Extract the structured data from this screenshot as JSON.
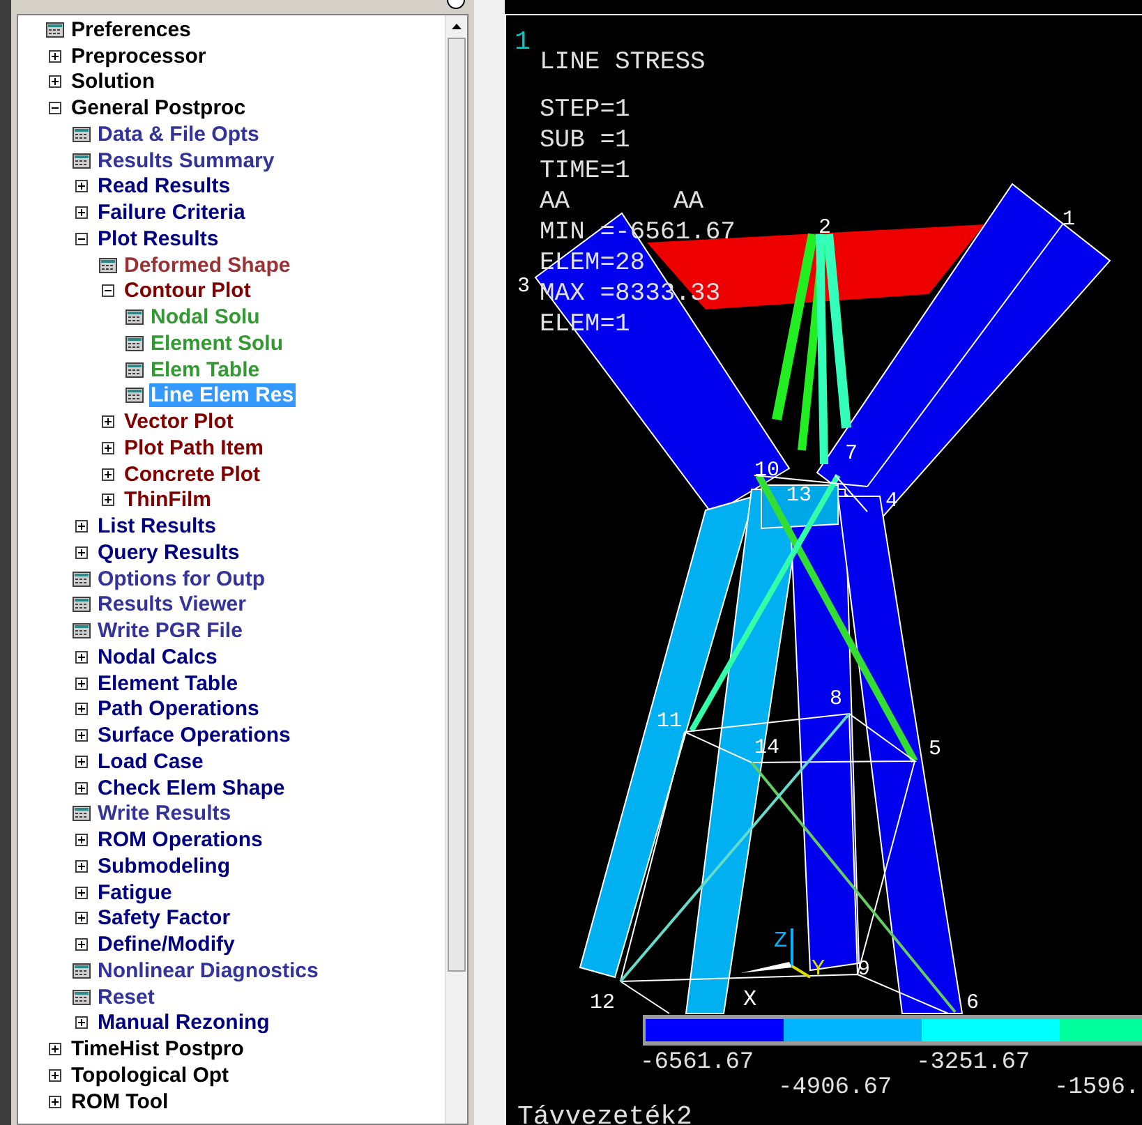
{
  "menu": {
    "items": [
      {
        "label": "Preferences",
        "kind": "function",
        "selected": false,
        "color": "#000000"
      },
      {
        "label": "Preprocessor",
        "kind": "folder",
        "expanded": false,
        "selected": false,
        "color": "#000000"
      },
      {
        "label": "Solution",
        "kind": "folder",
        "expanded": false,
        "selected": false,
        "color": "#000000"
      },
      {
        "label": "General Postproc",
        "kind": "folder",
        "expanded": true,
        "selected": false,
        "color": "#000000",
        "children": [
          {
            "label": "Data & File Opts",
            "kind": "function",
            "selected": false,
            "color": "#333399"
          },
          {
            "label": "Results Summary",
            "kind": "function",
            "selected": false,
            "color": "#333399"
          },
          {
            "label": "Read Results",
            "kind": "folder",
            "expanded": false,
            "selected": false,
            "color": "#000080"
          },
          {
            "label": "Failure Criteria",
            "kind": "folder",
            "expanded": false,
            "selected": false,
            "color": "#000080"
          },
          {
            "label": "Plot Results",
            "kind": "folder",
            "expanded": true,
            "selected": false,
            "color": "#000080",
            "children": [
              {
                "label": "Deformed Shape",
                "kind": "function",
                "selected": false,
                "color": "#993333"
              },
              {
                "label": "Contour Plot",
                "kind": "folder",
                "expanded": true,
                "selected": false,
                "color": "#800000",
                "children": [
                  {
                    "label": "Nodal Solu",
                    "kind": "function",
                    "selected": false,
                    "color": "#339933"
                  },
                  {
                    "label": "Element Solu",
                    "kind": "function",
                    "selected": false,
                    "color": "#339933"
                  },
                  {
                    "label": "Elem Table",
                    "kind": "function",
                    "selected": false,
                    "color": "#339933"
                  },
                  {
                    "label": "Line Elem Res",
                    "kind": "function",
                    "selected": true
                  }
                ]
              },
              {
                "label": "Vector Plot",
                "kind": "folder",
                "expanded": false,
                "selected": false,
                "color": "#800000"
              },
              {
                "label": "Plot Path Item",
                "kind": "folder",
                "expanded": false,
                "selected": false,
                "color": "#800000"
              },
              {
                "label": "Concrete Plot",
                "kind": "folder",
                "expanded": false,
                "selected": false,
                "color": "#800000"
              },
              {
                "label": "ThinFilm",
                "kind": "folder",
                "expanded": false,
                "selected": false,
                "color": "#800000"
              }
            ]
          },
          {
            "label": "List Results",
            "kind": "folder",
            "expanded": false,
            "selected": false,
            "color": "#000080"
          },
          {
            "label": "Query Results",
            "kind": "folder",
            "expanded": false,
            "selected": false,
            "color": "#000080"
          },
          {
            "label": "Options for Outp",
            "kind": "function",
            "selected": false,
            "color": "#333399"
          },
          {
            "label": "Results Viewer",
            "kind": "function",
            "selected": false,
            "color": "#333399"
          },
          {
            "label": "Write PGR File",
            "kind": "function",
            "selected": false,
            "color": "#333399"
          },
          {
            "label": "Nodal Calcs",
            "kind": "folder",
            "expanded": false,
            "selected": false,
            "color": "#000080"
          },
          {
            "label": "Element Table",
            "kind": "folder",
            "expanded": false,
            "selected": false,
            "color": "#000080"
          },
          {
            "label": "Path Operations",
            "kind": "folder",
            "expanded": false,
            "selected": false,
            "color": "#000080"
          },
          {
            "label": "Surface Operations",
            "kind": "folder",
            "expanded": false,
            "selected": false,
            "color": "#000080"
          },
          {
            "label": "Load Case",
            "kind": "folder",
            "expanded": false,
            "selected": false,
            "color": "#000080"
          },
          {
            "label": "Check Elem Shape",
            "kind": "folder",
            "expanded": false,
            "selected": false,
            "color": "#000080"
          },
          {
            "label": "Write Results",
            "kind": "function",
            "selected": false,
            "color": "#333399"
          },
          {
            "label": "ROM Operations",
            "kind": "folder",
            "expanded": false,
            "selected": false,
            "color": "#000080"
          },
          {
            "label": "Submodeling",
            "kind": "folder",
            "expanded": false,
            "selected": false,
            "color": "#000080"
          },
          {
            "label": "Fatigue",
            "kind": "folder",
            "expanded": false,
            "selected": false,
            "color": "#000080"
          },
          {
            "label": "Safety Factor",
            "kind": "folder",
            "expanded": false,
            "selected": false,
            "color": "#000080"
          },
          {
            "label": "Define/Modify",
            "kind": "folder",
            "expanded": false,
            "selected": false,
            "color": "#000080"
          },
          {
            "label": "Nonlinear Diagnostics",
            "kind": "function",
            "selected": false,
            "color": "#333399"
          },
          {
            "label": "Reset",
            "kind": "function",
            "selected": false,
            "color": "#333399"
          },
          {
            "label": "Manual Rezoning",
            "kind": "folder",
            "expanded": false,
            "selected": false,
            "color": "#000080"
          }
        ]
      },
      {
        "label": "TimeHist Postpro",
        "kind": "folder",
        "expanded": false,
        "selected": false,
        "color": "#000000"
      },
      {
        "label": "Topological Opt",
        "kind": "folder",
        "expanded": false,
        "selected": false,
        "color": "#000000"
      },
      {
        "label": "ROM Tool",
        "kind": "folder",
        "expanded": false,
        "selected": false,
        "color": "#000000"
      }
    ]
  },
  "plot": {
    "window_number": "1",
    "title": "LINE STRESS",
    "info": [
      "STEP=1",
      "SUB =1",
      "TIME=1"
    ],
    "aa": [
      "AA",
      "AA"
    ],
    "stats": [
      "MIN =-6561.67",
      "ELEM=28",
      "MAX =8333.33",
      "ELEM=1"
    ],
    "nodes": [
      "1",
      "2",
      "3",
      "4",
      "5",
      "6",
      "7",
      "8",
      "9",
      "10",
      "11",
      "12",
      "13",
      "14"
    ],
    "axes": [
      "X",
      "Y",
      "Z"
    ],
    "legend": [
      {
        "label": "-6561.67",
        "color": "#0000ff"
      },
      {
        "label": "-4906.67",
        "color": "#00b4ff"
      },
      {
        "label": "-3251.67",
        "color": "#00ffff"
      },
      {
        "label": "-1596.",
        "color": "#00ff9c"
      }
    ],
    "caption": "Távvezeték2"
  }
}
